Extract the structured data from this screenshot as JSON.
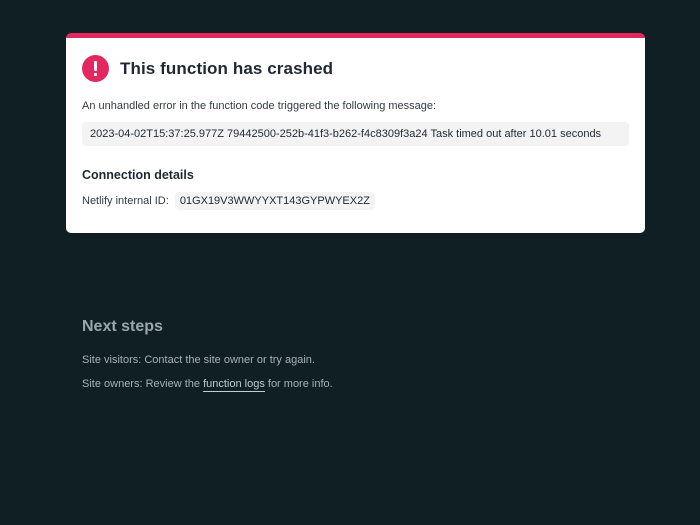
{
  "card": {
    "title": "This function has crashed",
    "intro": "An unhandled error in the function code triggered the following message:",
    "error_message": "2023-04-02T15:37:25.977Z 79442500-252b-41f3-b262-f4c8309f3a24 Task timed out after 10.01 seconds",
    "details_title": "Connection details",
    "internal_id_label": "Netlify internal ID:",
    "internal_id_value": "01GX19V3WWYYXT143GYPWYEX2Z",
    "accent_color": "#e2285e",
    "icon": "exclamation-icon"
  },
  "next_steps": {
    "title": "Next steps",
    "visitors_text": "Site visitors: Contact the site owner or try again.",
    "owners_prefix": "Site owners: Review the ",
    "owners_link": "function logs",
    "owners_suffix": " for more info."
  }
}
